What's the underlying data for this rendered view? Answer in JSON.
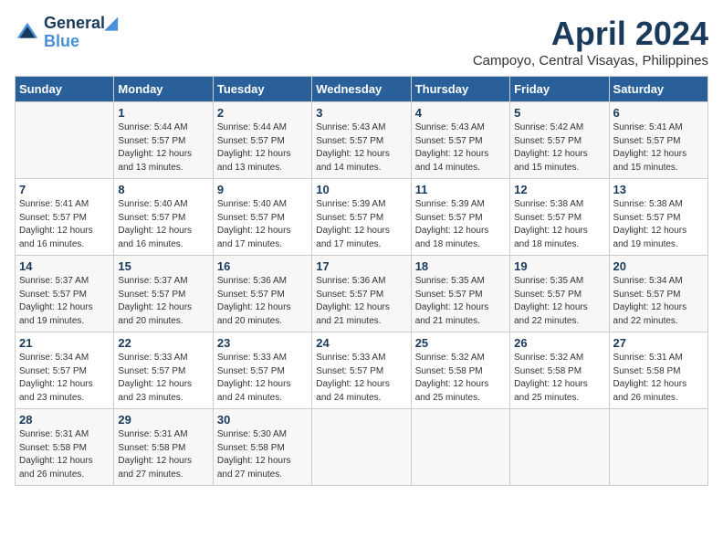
{
  "logo": {
    "line1": "General",
    "line2": "Blue"
  },
  "title": "April 2024",
  "subtitle": "Campoyo, Central Visayas, Philippines",
  "headers": [
    "Sunday",
    "Monday",
    "Tuesday",
    "Wednesday",
    "Thursday",
    "Friday",
    "Saturday"
  ],
  "weeks": [
    [
      {
        "day": "",
        "sunrise": "",
        "sunset": "",
        "daylight": ""
      },
      {
        "day": "1",
        "sunrise": "Sunrise: 5:44 AM",
        "sunset": "Sunset: 5:57 PM",
        "daylight": "Daylight: 12 hours and 13 minutes."
      },
      {
        "day": "2",
        "sunrise": "Sunrise: 5:44 AM",
        "sunset": "Sunset: 5:57 PM",
        "daylight": "Daylight: 12 hours and 13 minutes."
      },
      {
        "day": "3",
        "sunrise": "Sunrise: 5:43 AM",
        "sunset": "Sunset: 5:57 PM",
        "daylight": "Daylight: 12 hours and 14 minutes."
      },
      {
        "day": "4",
        "sunrise": "Sunrise: 5:43 AM",
        "sunset": "Sunset: 5:57 PM",
        "daylight": "Daylight: 12 hours and 14 minutes."
      },
      {
        "day": "5",
        "sunrise": "Sunrise: 5:42 AM",
        "sunset": "Sunset: 5:57 PM",
        "daylight": "Daylight: 12 hours and 15 minutes."
      },
      {
        "day": "6",
        "sunrise": "Sunrise: 5:41 AM",
        "sunset": "Sunset: 5:57 PM",
        "daylight": "Daylight: 12 hours and 15 minutes."
      }
    ],
    [
      {
        "day": "7",
        "sunrise": "Sunrise: 5:41 AM",
        "sunset": "Sunset: 5:57 PM",
        "daylight": "Daylight: 12 hours and 16 minutes."
      },
      {
        "day": "8",
        "sunrise": "Sunrise: 5:40 AM",
        "sunset": "Sunset: 5:57 PM",
        "daylight": "Daylight: 12 hours and 16 minutes."
      },
      {
        "day": "9",
        "sunrise": "Sunrise: 5:40 AM",
        "sunset": "Sunset: 5:57 PM",
        "daylight": "Daylight: 12 hours and 17 minutes."
      },
      {
        "day": "10",
        "sunrise": "Sunrise: 5:39 AM",
        "sunset": "Sunset: 5:57 PM",
        "daylight": "Daylight: 12 hours and 17 minutes."
      },
      {
        "day": "11",
        "sunrise": "Sunrise: 5:39 AM",
        "sunset": "Sunset: 5:57 PM",
        "daylight": "Daylight: 12 hours and 18 minutes."
      },
      {
        "day": "12",
        "sunrise": "Sunrise: 5:38 AM",
        "sunset": "Sunset: 5:57 PM",
        "daylight": "Daylight: 12 hours and 18 minutes."
      },
      {
        "day": "13",
        "sunrise": "Sunrise: 5:38 AM",
        "sunset": "Sunset: 5:57 PM",
        "daylight": "Daylight: 12 hours and 19 minutes."
      }
    ],
    [
      {
        "day": "14",
        "sunrise": "Sunrise: 5:37 AM",
        "sunset": "Sunset: 5:57 PM",
        "daylight": "Daylight: 12 hours and 19 minutes."
      },
      {
        "day": "15",
        "sunrise": "Sunrise: 5:37 AM",
        "sunset": "Sunset: 5:57 PM",
        "daylight": "Daylight: 12 hours and 20 minutes."
      },
      {
        "day": "16",
        "sunrise": "Sunrise: 5:36 AM",
        "sunset": "Sunset: 5:57 PM",
        "daylight": "Daylight: 12 hours and 20 minutes."
      },
      {
        "day": "17",
        "sunrise": "Sunrise: 5:36 AM",
        "sunset": "Sunset: 5:57 PM",
        "daylight": "Daylight: 12 hours and 21 minutes."
      },
      {
        "day": "18",
        "sunrise": "Sunrise: 5:35 AM",
        "sunset": "Sunset: 5:57 PM",
        "daylight": "Daylight: 12 hours and 21 minutes."
      },
      {
        "day": "19",
        "sunrise": "Sunrise: 5:35 AM",
        "sunset": "Sunset: 5:57 PM",
        "daylight": "Daylight: 12 hours and 22 minutes."
      },
      {
        "day": "20",
        "sunrise": "Sunrise: 5:34 AM",
        "sunset": "Sunset: 5:57 PM",
        "daylight": "Daylight: 12 hours and 22 minutes."
      }
    ],
    [
      {
        "day": "21",
        "sunrise": "Sunrise: 5:34 AM",
        "sunset": "Sunset: 5:57 PM",
        "daylight": "Daylight: 12 hours and 23 minutes."
      },
      {
        "day": "22",
        "sunrise": "Sunrise: 5:33 AM",
        "sunset": "Sunset: 5:57 PM",
        "daylight": "Daylight: 12 hours and 23 minutes."
      },
      {
        "day": "23",
        "sunrise": "Sunrise: 5:33 AM",
        "sunset": "Sunset: 5:57 PM",
        "daylight": "Daylight: 12 hours and 24 minutes."
      },
      {
        "day": "24",
        "sunrise": "Sunrise: 5:33 AM",
        "sunset": "Sunset: 5:57 PM",
        "daylight": "Daylight: 12 hours and 24 minutes."
      },
      {
        "day": "25",
        "sunrise": "Sunrise: 5:32 AM",
        "sunset": "Sunset: 5:58 PM",
        "daylight": "Daylight: 12 hours and 25 minutes."
      },
      {
        "day": "26",
        "sunrise": "Sunrise: 5:32 AM",
        "sunset": "Sunset: 5:58 PM",
        "daylight": "Daylight: 12 hours and 25 minutes."
      },
      {
        "day": "27",
        "sunrise": "Sunrise: 5:31 AM",
        "sunset": "Sunset: 5:58 PM",
        "daylight": "Daylight: 12 hours and 26 minutes."
      }
    ],
    [
      {
        "day": "28",
        "sunrise": "Sunrise: 5:31 AM",
        "sunset": "Sunset: 5:58 PM",
        "daylight": "Daylight: 12 hours and 26 minutes."
      },
      {
        "day": "29",
        "sunrise": "Sunrise: 5:31 AM",
        "sunset": "Sunset: 5:58 PM",
        "daylight": "Daylight: 12 hours and 27 minutes."
      },
      {
        "day": "30",
        "sunrise": "Sunrise: 5:30 AM",
        "sunset": "Sunset: 5:58 PM",
        "daylight": "Daylight: 12 hours and 27 minutes."
      },
      {
        "day": "",
        "sunrise": "",
        "sunset": "",
        "daylight": ""
      },
      {
        "day": "",
        "sunrise": "",
        "sunset": "",
        "daylight": ""
      },
      {
        "day": "",
        "sunrise": "",
        "sunset": "",
        "daylight": ""
      },
      {
        "day": "",
        "sunrise": "",
        "sunset": "",
        "daylight": ""
      }
    ]
  ]
}
